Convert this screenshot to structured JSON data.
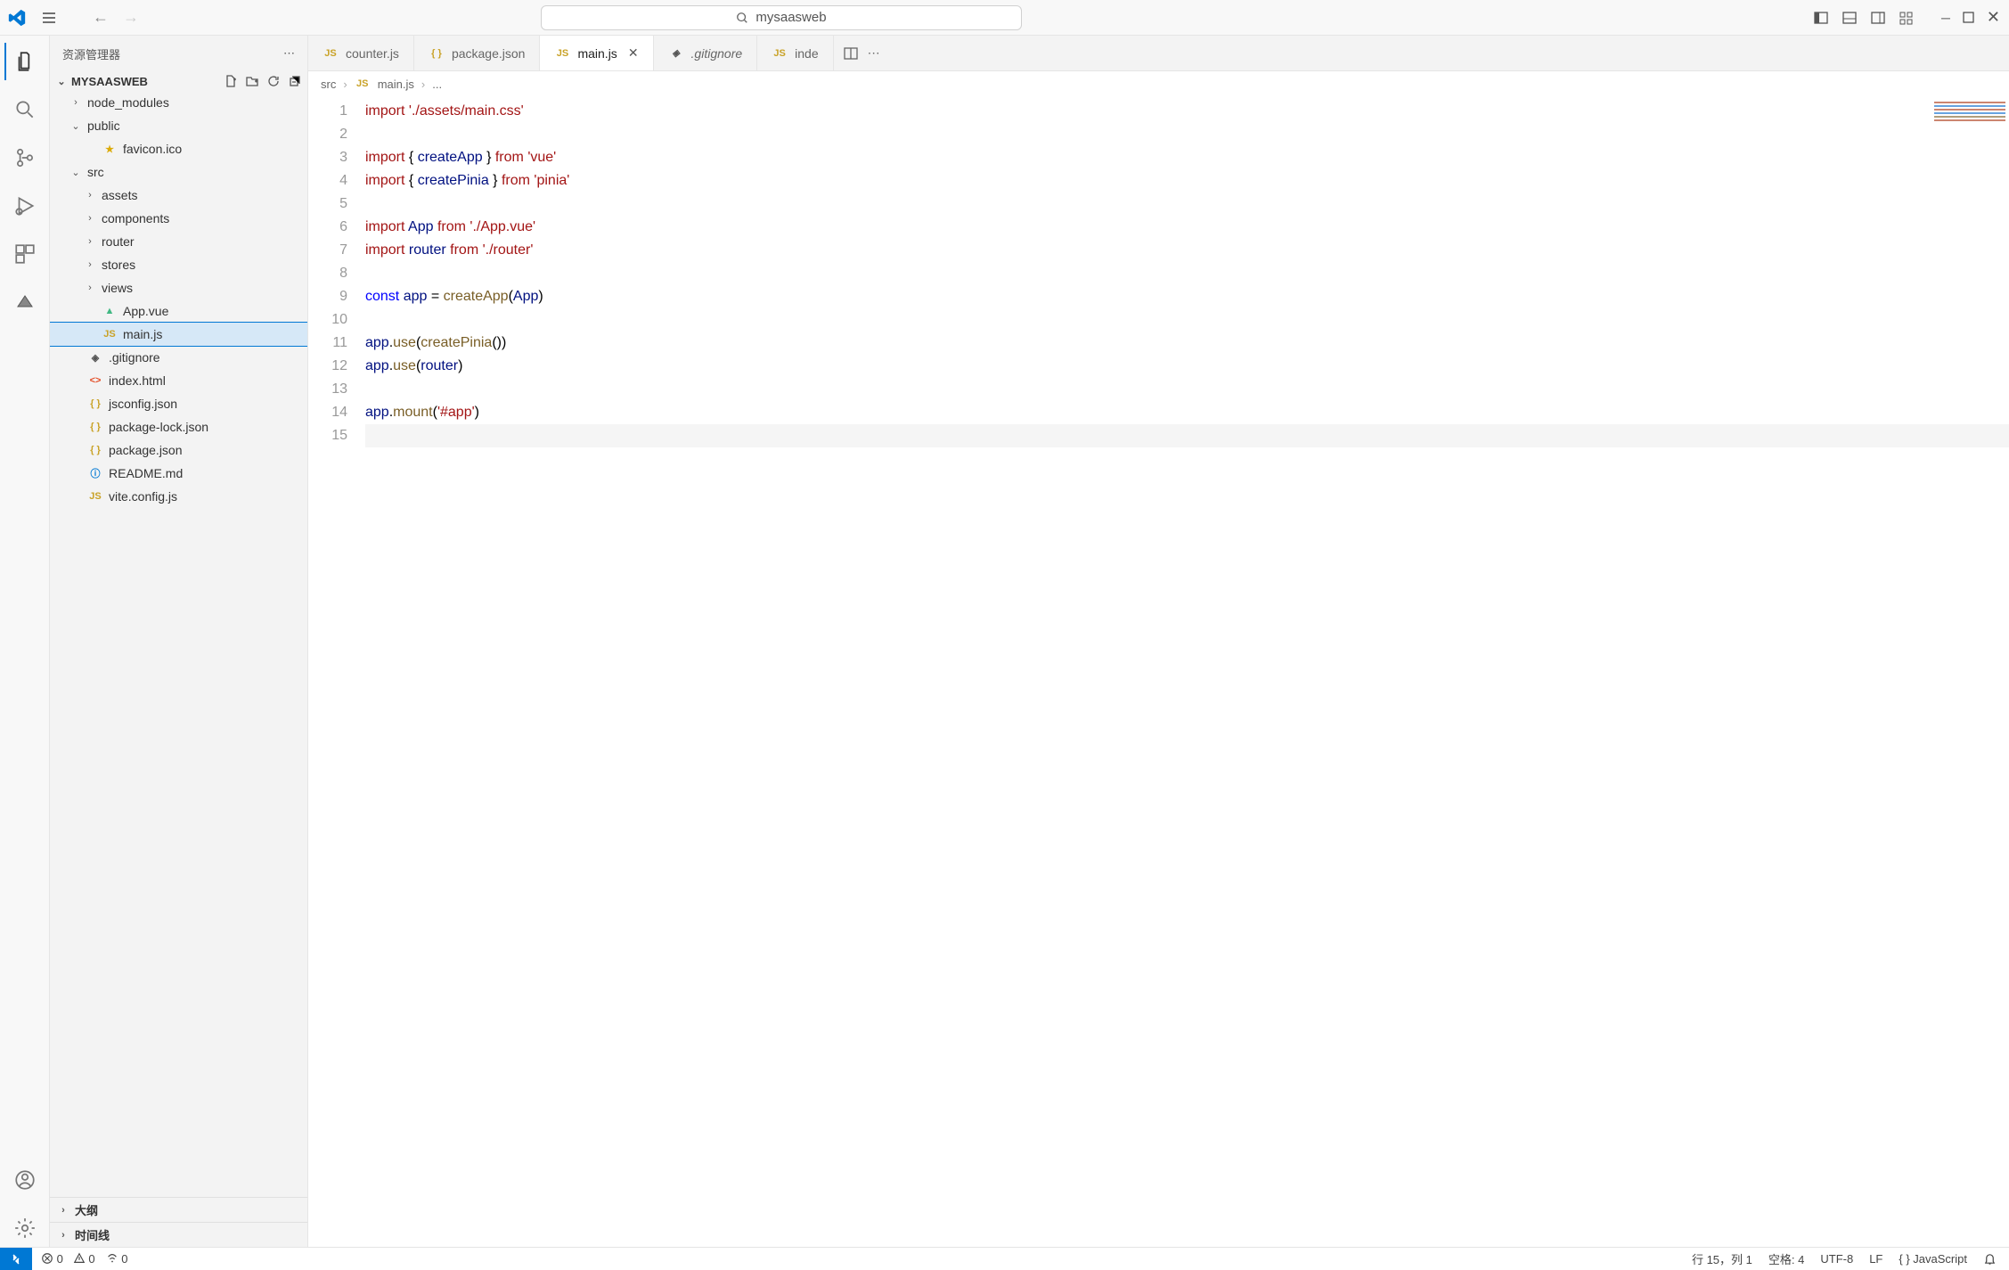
{
  "title": {
    "search_text": "mysaasweb"
  },
  "sidebar": {
    "title": "资源管理器",
    "project": "MYSAASWEB",
    "tree": [
      {
        "kind": "folder",
        "name": "node_modules",
        "expanded": false,
        "indent": 1
      },
      {
        "kind": "folder",
        "name": "public",
        "expanded": true,
        "indent": 1
      },
      {
        "kind": "file",
        "name": "favicon.ico",
        "icon": "star",
        "indent": 2
      },
      {
        "kind": "folder",
        "name": "src",
        "expanded": true,
        "indent": 1
      },
      {
        "kind": "folder",
        "name": "assets",
        "expanded": false,
        "indent": 2
      },
      {
        "kind": "folder",
        "name": "components",
        "expanded": false,
        "indent": 2
      },
      {
        "kind": "folder",
        "name": "router",
        "expanded": false,
        "indent": 2
      },
      {
        "kind": "folder",
        "name": "stores",
        "expanded": false,
        "indent": 2
      },
      {
        "kind": "folder",
        "name": "views",
        "expanded": false,
        "indent": 2
      },
      {
        "kind": "file",
        "name": "App.vue",
        "icon": "vue",
        "indent": 2
      },
      {
        "kind": "file",
        "name": "main.js",
        "icon": "js",
        "indent": 2,
        "selected": true
      },
      {
        "kind": "file",
        "name": ".gitignore",
        "icon": "gitignore",
        "indent": 1
      },
      {
        "kind": "file",
        "name": "index.html",
        "icon": "html",
        "indent": 1
      },
      {
        "kind": "file",
        "name": "jsconfig.json",
        "icon": "json",
        "indent": 1
      },
      {
        "kind": "file",
        "name": "package-lock.json",
        "icon": "json",
        "indent": 1
      },
      {
        "kind": "file",
        "name": "package.json",
        "icon": "json",
        "indent": 1
      },
      {
        "kind": "file",
        "name": "README.md",
        "icon": "md",
        "indent": 1
      },
      {
        "kind": "file",
        "name": "vite.config.js",
        "icon": "js",
        "indent": 1
      }
    ],
    "outline": "大纲",
    "timeline": "时间线"
  },
  "tabs": [
    {
      "label": "counter.js",
      "icon": "js",
      "active": false,
      "italic": false
    },
    {
      "label": "package.json",
      "icon": "json",
      "active": false,
      "italic": false
    },
    {
      "label": "main.js",
      "icon": "js",
      "active": true,
      "italic": false,
      "close": true
    },
    {
      "label": ".gitignore",
      "icon": "gitignore",
      "active": false,
      "italic": true
    },
    {
      "label": "inde",
      "icon": "js",
      "active": false,
      "italic": false
    }
  ],
  "breadcrumbs": {
    "seg0": "src",
    "seg1": "main.js",
    "seg2": "..."
  },
  "code": {
    "lines": [
      [
        [
          "kw",
          "import"
        ],
        [
          "punc",
          " "
        ],
        [
          "str",
          "'./assets/main.css'"
        ]
      ],
      [],
      [
        [
          "kw",
          "import"
        ],
        [
          "punc",
          " { "
        ],
        [
          "ident",
          "createApp"
        ],
        [
          "punc",
          " } "
        ],
        [
          "kw",
          "from"
        ],
        [
          "punc",
          " "
        ],
        [
          "str",
          "'vue'"
        ]
      ],
      [
        [
          "kw",
          "import"
        ],
        [
          "punc",
          " { "
        ],
        [
          "ident",
          "createPinia"
        ],
        [
          "punc",
          " } "
        ],
        [
          "kw",
          "from"
        ],
        [
          "punc",
          " "
        ],
        [
          "str",
          "'pinia'"
        ]
      ],
      [],
      [
        [
          "kw",
          "import"
        ],
        [
          "punc",
          " "
        ],
        [
          "ident",
          "App"
        ],
        [
          "punc",
          " "
        ],
        [
          "kw",
          "from"
        ],
        [
          "punc",
          " "
        ],
        [
          "str",
          "'./App.vue'"
        ]
      ],
      [
        [
          "kw",
          "import"
        ],
        [
          "punc",
          " "
        ],
        [
          "ident",
          "router"
        ],
        [
          "punc",
          " "
        ],
        [
          "kw",
          "from"
        ],
        [
          "punc",
          " "
        ],
        [
          "str",
          "'./router'"
        ]
      ],
      [],
      [
        [
          "kw-blue",
          "const"
        ],
        [
          "punc",
          " "
        ],
        [
          "ident",
          "app"
        ],
        [
          "punc",
          " = "
        ],
        [
          "fn",
          "createApp"
        ],
        [
          "punc",
          "("
        ],
        [
          "ident",
          "App"
        ],
        [
          "punc",
          ")"
        ]
      ],
      [],
      [
        [
          "ident",
          "app"
        ],
        [
          "punc",
          "."
        ],
        [
          "fn",
          "use"
        ],
        [
          "punc",
          "("
        ],
        [
          "fn",
          "createPinia"
        ],
        [
          "punc",
          "())"
        ]
      ],
      [
        [
          "ident",
          "app"
        ],
        [
          "punc",
          "."
        ],
        [
          "fn",
          "use"
        ],
        [
          "punc",
          "("
        ],
        [
          "ident",
          "router"
        ],
        [
          "punc",
          ")"
        ]
      ],
      [],
      [
        [
          "ident",
          "app"
        ],
        [
          "punc",
          "."
        ],
        [
          "fn",
          "mount"
        ],
        [
          "punc",
          "("
        ],
        [
          "str",
          "'#app'"
        ],
        [
          "punc",
          ")"
        ]
      ],
      []
    ],
    "current_line": 15
  },
  "status": {
    "errors": "0",
    "warnings": "0",
    "ports": "0",
    "cursor": "行 15，列 1",
    "spaces": "空格: 4",
    "encoding": "UTF-8",
    "eol": "LF",
    "lang": "JavaScript"
  }
}
